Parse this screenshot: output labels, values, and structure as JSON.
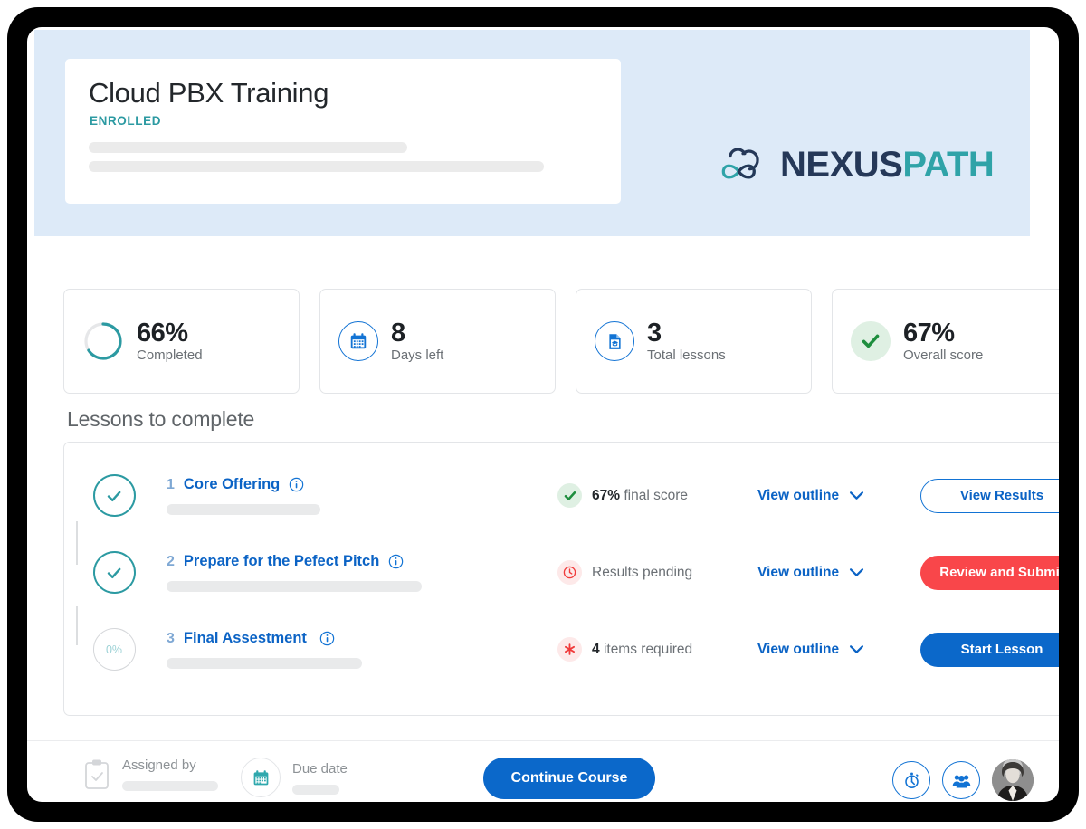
{
  "hero": {
    "course_title": "Cloud PBX Training",
    "status_badge": "ENROLLED",
    "brand": {
      "name_primary": "NEXUS",
      "name_secondary": "PATH",
      "color_primary": "#253858",
      "color_secondary": "#2fa3a8"
    },
    "background_color": "#ddeaf8"
  },
  "stats": [
    {
      "value": "66%",
      "label": "Completed",
      "icon": "progress-ring-icon",
      "progress_percent": 66,
      "accent": "#2c9aa2"
    },
    {
      "value": "8",
      "label": "Days left",
      "icon": "calendar-icon",
      "accent": "#1273d4"
    },
    {
      "value": "3",
      "label": "Total lessons",
      "icon": "lesson-document-icon",
      "accent": "#1273d4"
    },
    {
      "value": "67%",
      "label": "Overall score",
      "icon": "check-circle-icon",
      "accent": "#1e8e3e"
    }
  ],
  "lessons_section": {
    "heading": "Lessons to complete",
    "outline_label": "View outline",
    "rows": [
      {
        "number": "1",
        "title": "Core Offering",
        "info_icon": "info-icon",
        "timeline_state": "complete",
        "timeline_icon": "check-icon",
        "status_icon": "check-circle-icon",
        "status_value": "67%",
        "status_text": "final score",
        "action_label": "View Results",
        "action_style": "outline"
      },
      {
        "number": "2",
        "title": "Prepare for the Pefect Pitch",
        "info_icon": "info-icon",
        "timeline_state": "complete",
        "timeline_icon": "check-icon",
        "status_icon": "clock-icon",
        "status_value": "",
        "status_text": "Results pending",
        "action_label": "Review and Submit",
        "action_style": "red"
      },
      {
        "number": "3",
        "title": "Final Assestment",
        "info_icon": "info-icon",
        "timeline_state": "todo",
        "timeline_percent": "0%",
        "status_icon": "asterisk-icon",
        "status_value": "4",
        "status_text": "items required",
        "action_label": "Start Lesson",
        "action_style": "blue"
      }
    ]
  },
  "footer": {
    "assigned_by_label": "Assigned by",
    "assigned_by_icon": "clipboard-check-icon",
    "due_date_label": "Due date",
    "due_date_icon": "calendar-icon",
    "continue_label": "Continue Course",
    "tools": [
      {
        "icon": "stopwatch-icon"
      },
      {
        "icon": "group-people-icon"
      },
      {
        "icon": "avatar"
      }
    ]
  },
  "colors": {
    "primary_blue": "#0b68ca",
    "link_blue": "#0b63c5",
    "teal": "#2c9aa2",
    "red": "#f9464a",
    "green": "#1e8e3e",
    "hero_bg": "#ddeaf8"
  }
}
